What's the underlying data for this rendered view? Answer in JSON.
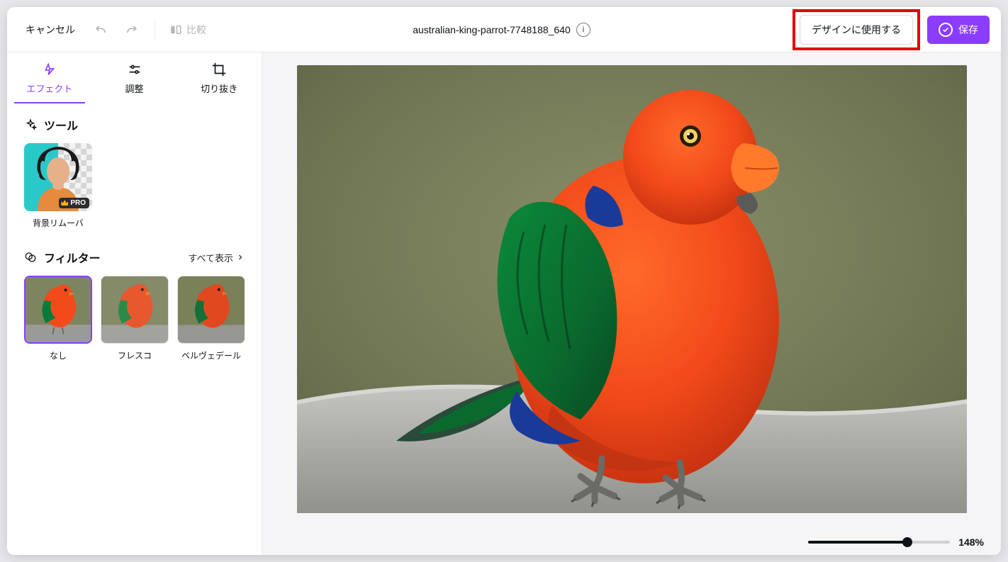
{
  "header": {
    "cancel": "キャンセル",
    "compare": "比較",
    "filename": "australian-king-parrot-7748188_640",
    "use_in_design": "デザインに使用する",
    "save": "保存"
  },
  "tabs": {
    "effects": "エフェクト",
    "adjust": "調整",
    "crop": "切り抜き"
  },
  "sections": {
    "tools_title": "ツール",
    "filters_title": "フィルター",
    "show_all": "すべて表示"
  },
  "tools": {
    "bg_remover": {
      "label": "背景リムーバ",
      "badge": "PRO"
    }
  },
  "filters": [
    {
      "id": "none",
      "label": "なし",
      "selected": true
    },
    {
      "id": "fresco",
      "label": "フレスコ",
      "selected": false
    },
    {
      "id": "belvedere",
      "label": "ベルヴェデール",
      "selected": false
    }
  ],
  "zoom": {
    "value": "148%"
  }
}
